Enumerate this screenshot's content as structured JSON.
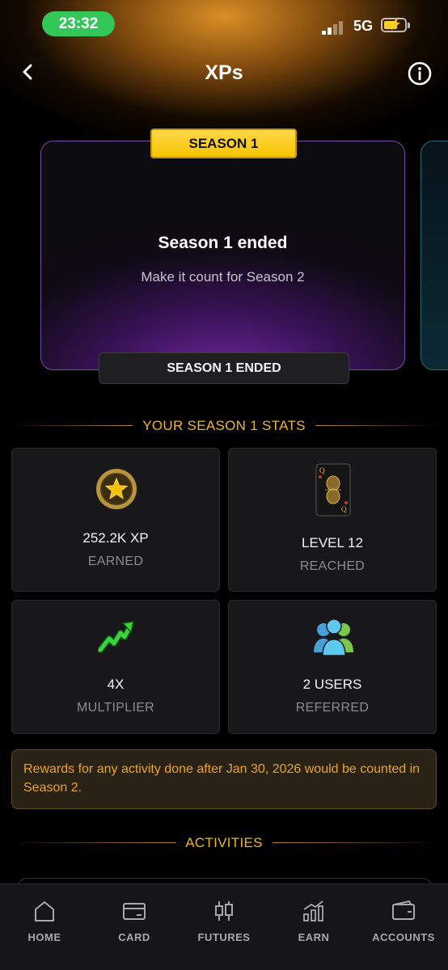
{
  "status_bar": {
    "time": "23:32",
    "network": "5G"
  },
  "header": {
    "title": "XPs"
  },
  "season_card": {
    "badge": "SEASON 1",
    "title": "Season 1 ended",
    "subtitle": "Make it count for Season 2",
    "button_label": "SEASON 1 ENDED"
  },
  "stats_section": {
    "title": "YOUR SEASON 1 STATS",
    "items": [
      {
        "value": "252.2K XP",
        "label": "EARNED",
        "icon": "star-coin-icon"
      },
      {
        "value": "LEVEL 12",
        "label": "REACHED",
        "icon": "level-card-icon"
      },
      {
        "value": "4X",
        "label": "MULTIPLIER",
        "icon": "trending-arrow-icon"
      },
      {
        "value": "2 USERS",
        "label": "REFERRED",
        "icon": "users-icon"
      }
    ]
  },
  "notice": {
    "text": "Rewards for any activity done after Jan 30, 2026 would be counted in Season 2."
  },
  "activities_section": {
    "title": "ACTIVITIES"
  },
  "bottom_nav": {
    "items": [
      {
        "label": "HOME",
        "icon": "home-icon"
      },
      {
        "label": "CARD",
        "icon": "card-icon"
      },
      {
        "label": "FUTURES",
        "icon": "candlestick-icon"
      },
      {
        "label": "EARN",
        "icon": "earn-chart-icon"
      },
      {
        "label": "ACCOUNTS",
        "icon": "wallet-icon"
      }
    ]
  },
  "colors": {
    "accent_gold": "#f0b429",
    "badge_yellow": "#f5c400",
    "card_purple": "#7a4aa8",
    "time_pill_green": "#33c759"
  }
}
